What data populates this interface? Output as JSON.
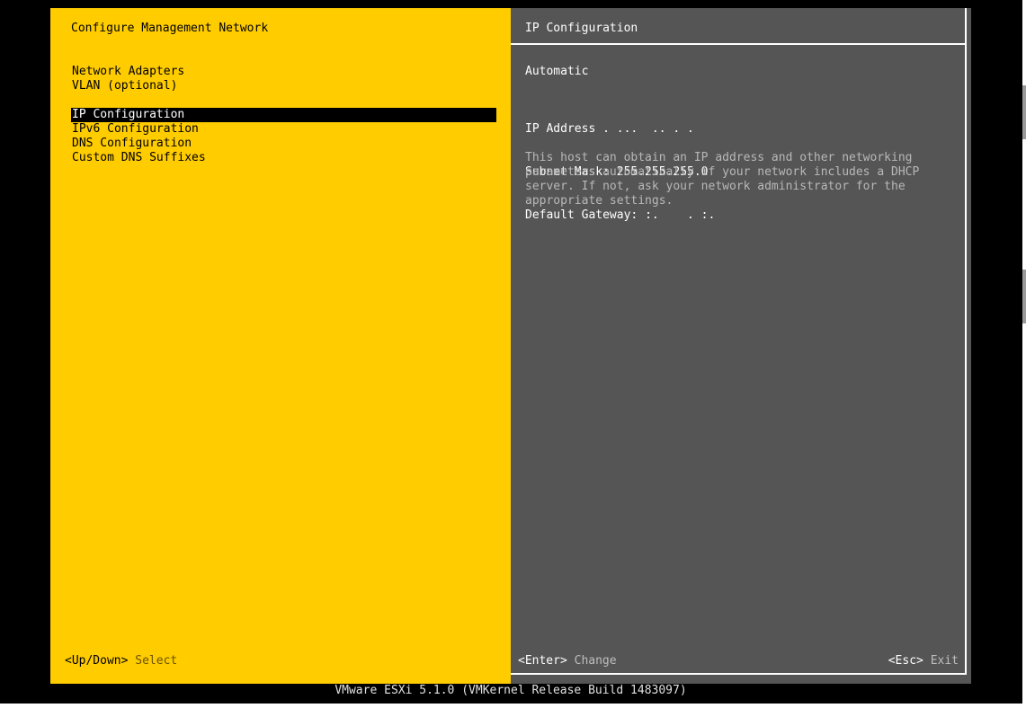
{
  "left_pane": {
    "title": "Configure Management Network",
    "menu_items": [
      "Network Adapters",
      "VLAN (optional)",
      "IP Configuration",
      "IPv6 Configuration",
      "DNS Configuration",
      "Custom DNS Suffixes"
    ],
    "selected_item": "IP Configuration"
  },
  "right_pane": {
    "title": "IP Configuration",
    "mode": "Automatic",
    "ip_address_label": "IP Address",
    "ip_address_value": ". ...  .. . .",
    "subnet_mask_label": "Subnet Mask:",
    "subnet_mask_value": "255.255.255.0",
    "default_gateway_label": "Default Gateway:",
    "default_gateway_value": ":.    . :.",
    "help_text": "This host can obtain an IP address and other networking\nparameters automatically if your network includes a DHCP\nserver. If not, ask your network administrator for the\nappropriate settings."
  },
  "footer": {
    "updown_key": "<Up/Down>",
    "updown_action": "Select",
    "enter_key": "<Enter>",
    "enter_action": "Change",
    "esc_key": "<Esc>",
    "esc_action": "Exit"
  },
  "status_bar": "VMware ESXi 5.1.0 (VMKernel Release Build 1483097)",
  "colors": {
    "left_pane": "#ffcc00",
    "right_pane": "#555555",
    "selection": "#000000"
  }
}
